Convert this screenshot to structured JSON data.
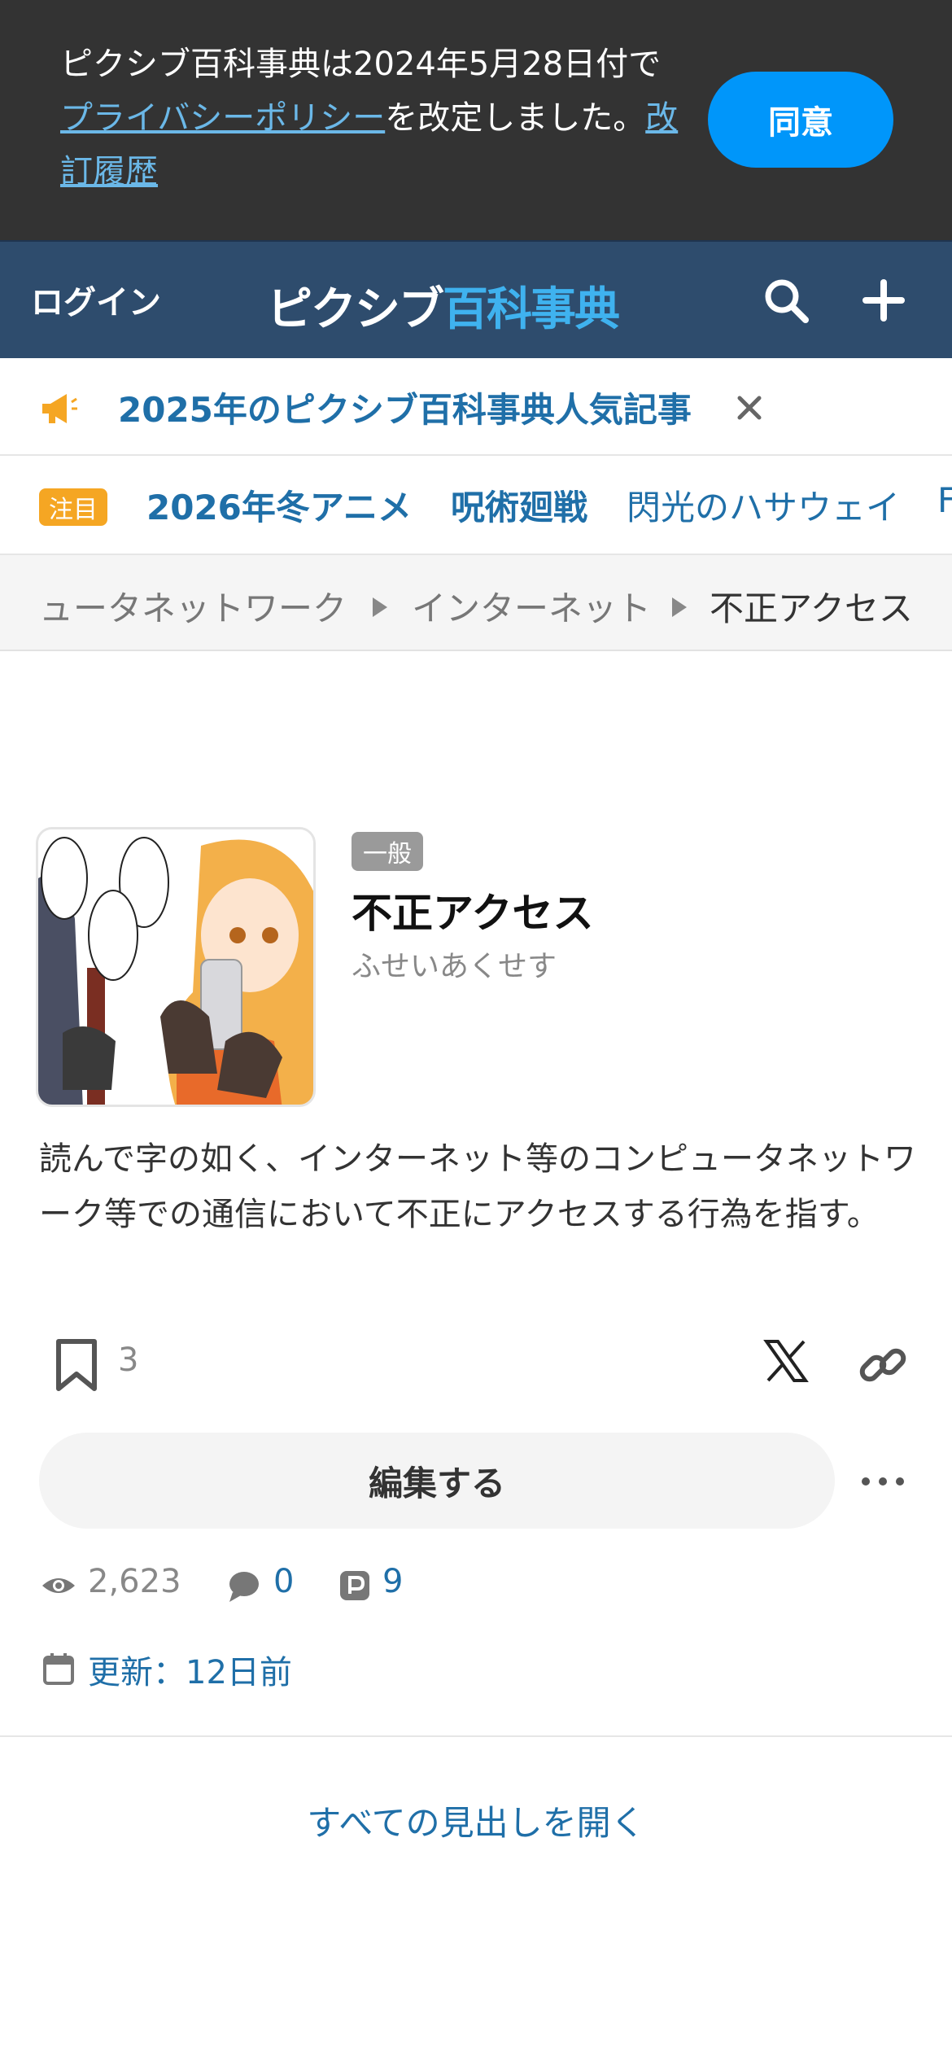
{
  "privacy_banner": {
    "text_before": "ピクシブ百科事典は2024年5月28日付で",
    "policy_link": "プライバシーポリシー",
    "text_after": "を改定しました。",
    "history_link": "改訂履歴",
    "agree_label": "同意"
  },
  "header": {
    "login_label": "ログイン",
    "logo_part1": "ピクシブ",
    "logo_part2": "百科事典"
  },
  "announcement": {
    "text": "2025年のピクシブ百科事典人気記事"
  },
  "trending": {
    "badge": "注目",
    "items": [
      "2026年冬アニメ",
      "呪術廻戦",
      "閃光のハサウェイ",
      "F"
    ]
  },
  "breadcrumb": {
    "items": [
      "ュータネットワーク",
      "インターネット",
      "不正アクセス"
    ]
  },
  "article": {
    "category_badge": "一般",
    "title": "不正アクセス",
    "reading": "ふせいあくせす",
    "summary": "読んで字の如く、インターネット等のコンピュータネットワーク等での通信において不正にアクセスする行為を指す。",
    "bookmark_count": "3",
    "edit_label": "編集する"
  },
  "stats": {
    "views": "2,623",
    "comments": "0",
    "pixiv_works": "9",
    "updated": "更新：12日前"
  },
  "open_all_label": "すべての見出しを開く"
}
